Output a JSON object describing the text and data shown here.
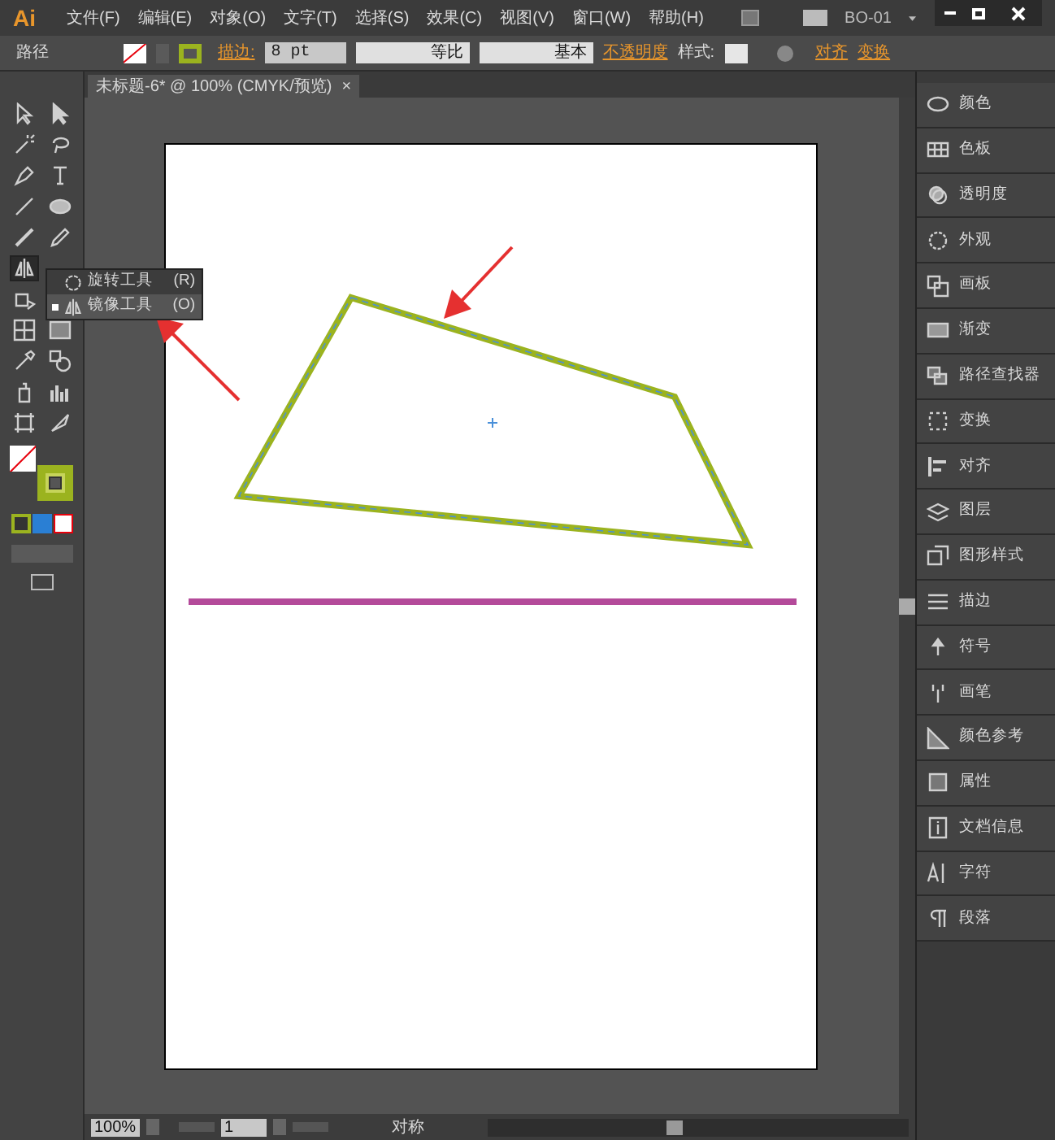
{
  "app": {
    "logo": "Ai",
    "workspace": "BO-01"
  },
  "menu": [
    "文件(F)",
    "编辑(E)",
    "对象(O)",
    "文字(T)",
    "选择(S)",
    "效果(C)",
    "视图(V)",
    "窗口(W)",
    "帮助(H)"
  ],
  "control_bar": {
    "selection": "路径",
    "stroke_label": "描边:",
    "stroke_weight": "8 pt",
    "profile": "等比",
    "brush": "基本",
    "opacity": "不透明度",
    "style_label": "样式:",
    "align": "对齐",
    "transform": "变换"
  },
  "document_tab": {
    "title": "未标题-6* @ 100% (CMYK/预览)",
    "close": "×"
  },
  "tools": [
    {
      "selected": false
    },
    {
      "selected": false
    },
    {
      "selected": false
    },
    {
      "selected": false
    },
    {
      "selected": false
    },
    {
      "selected": false
    },
    {
      "selected": false
    },
    {
      "selected": false
    },
    {
      "selected": false
    },
    {
      "selected": false
    },
    {
      "selected": true
    },
    {
      "selected": false
    },
    {
      "selected": false
    },
    {
      "selected": false
    },
    {
      "selected": false
    },
    {
      "selected": false
    },
    {
      "selected": false
    },
    {
      "selected": false
    },
    {
      "selected": false
    },
    {
      "selected": false
    }
  ],
  "flyout": [
    {
      "label": "旋转工具",
      "shortcut": "(R)",
      "selected": false
    },
    {
      "label": "镜像工具",
      "shortcut": "(O)",
      "selected": true
    }
  ],
  "panels": [
    "颜色",
    "色板",
    "透明度",
    "外观",
    "画板",
    "渐变",
    "路径查找器",
    "变换",
    "对齐",
    "图层",
    "图形样式",
    "描边",
    "符号",
    "画笔",
    "颜色参考",
    "属性",
    "文档信息",
    "字符",
    "段落"
  ],
  "status_bar": {
    "zoom": "100%",
    "artboard": "1",
    "tool": "对称"
  }
}
